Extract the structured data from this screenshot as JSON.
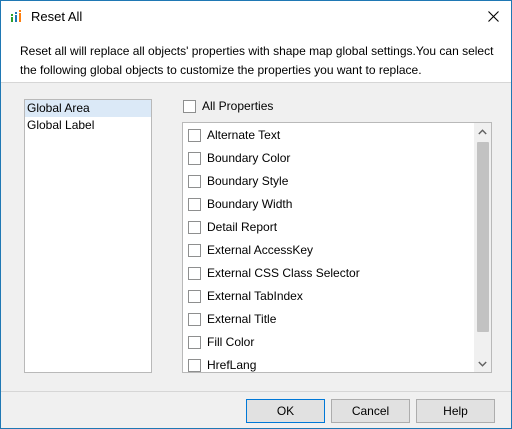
{
  "window": {
    "title": "Reset All",
    "accent_color": "#1f78b4"
  },
  "description": "Reset all will replace all objects' properties with shape map global settings.You can select the following global objects to customize the properties you want to replace.",
  "global_objects": [
    {
      "label": "Global Area",
      "selected": true
    },
    {
      "label": "Global Label",
      "selected": false
    }
  ],
  "all_properties": {
    "label": "All Properties",
    "checked": false
  },
  "properties": [
    {
      "label": "Alternate Text",
      "checked": false
    },
    {
      "label": "Boundary Color",
      "checked": false
    },
    {
      "label": "Boundary Style",
      "checked": false
    },
    {
      "label": "Boundary Width",
      "checked": false
    },
    {
      "label": "Detail Report",
      "checked": false
    },
    {
      "label": "External AccessKey",
      "checked": false
    },
    {
      "label": "External CSS Class Selector",
      "checked": false
    },
    {
      "label": "External TabIndex",
      "checked": false
    },
    {
      "label": "External Title",
      "checked": false
    },
    {
      "label": "Fill Color",
      "checked": false
    },
    {
      "label": "HrefLang",
      "checked": false
    }
  ],
  "buttons": {
    "ok": "OK",
    "cancel": "Cancel",
    "help": "Help"
  },
  "icons": {
    "app": "bar-chart-icon",
    "close": "close-icon",
    "scroll_up": "chevron-up-icon",
    "scroll_down": "chevron-down-icon"
  }
}
